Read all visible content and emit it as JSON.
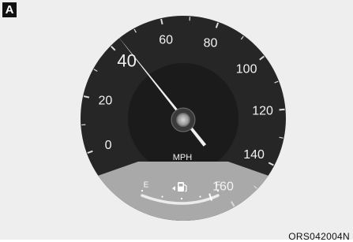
{
  "badge": {
    "label": "A"
  },
  "figure_code": "ORS042004N",
  "speedometer": {
    "unit": "MPH",
    "tick_labels": [
      "0",
      "20",
      "40",
      "60",
      "80",
      "100",
      "120",
      "140",
      "160"
    ],
    "min": 0,
    "max": 160,
    "needle_value": 44,
    "colors": {
      "dial": "#262626",
      "inner_dial": "#1b1b1b",
      "lower_panel": "#a9a9a9",
      "needle": "#f0f0f0",
      "text": "#f2f2f2"
    }
  },
  "fuel_gauge": {
    "empty_label": "E",
    "full_label": "F",
    "icon": "fuel-pump-icon",
    "level": 0.9
  }
}
